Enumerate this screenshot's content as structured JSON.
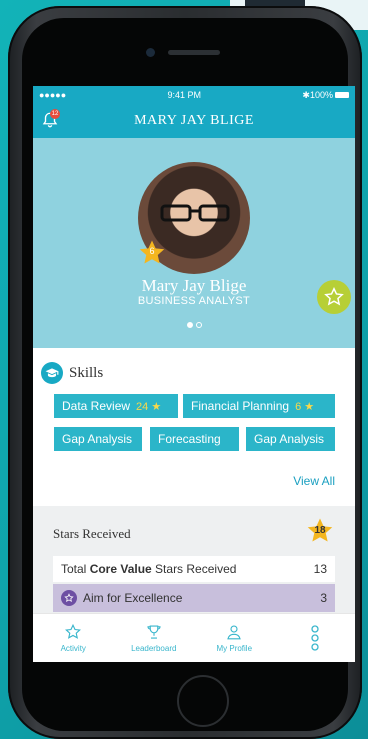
{
  "status_bar": {
    "signal": "●●●●● ",
    "time": "9:41 PM",
    "battery": "100%"
  },
  "header": {
    "title": "MARY JAY BLIGE",
    "notification_count": "12"
  },
  "profile": {
    "name": "Mary Jay Blige",
    "role": "BUSINESS ANALYST",
    "level": "6"
  },
  "skills": {
    "title": "Skills",
    "items": [
      {
        "label": "Data Review",
        "count": "24"
      },
      {
        "label": "Financial Planning",
        "count": "6"
      },
      {
        "label": "Gap Analysis",
        "count": ""
      },
      {
        "label": "Forecasting",
        "count": ""
      },
      {
        "label": "Gap Analysis",
        "count": ""
      }
    ],
    "view_all": "View All"
  },
  "stars_received": {
    "title": "Stars Received",
    "total": "18",
    "row_total_prefix": "Total ",
    "row_total_bold": "Core Value",
    "row_total_suffix": " Stars Received",
    "row_total_value": "13",
    "row_excellence_label": "Aim for Excellence",
    "row_excellence_value": "3"
  },
  "tabs": [
    {
      "label": "Activity",
      "icon": "star-outline-icon"
    },
    {
      "label": "Leaderboard",
      "icon": "trophy-icon"
    },
    {
      "label": "My Profile",
      "icon": "person-icon"
    },
    {
      "label": "",
      "icon": "more-dots-icon"
    }
  ],
  "colors": {
    "primary": "#18a9c4",
    "hero": "#8fd2df",
    "chip": "#2bb5c9",
    "accent": "#b7cf36",
    "star": "#f4b61f",
    "purple": "#c8bfdc"
  }
}
